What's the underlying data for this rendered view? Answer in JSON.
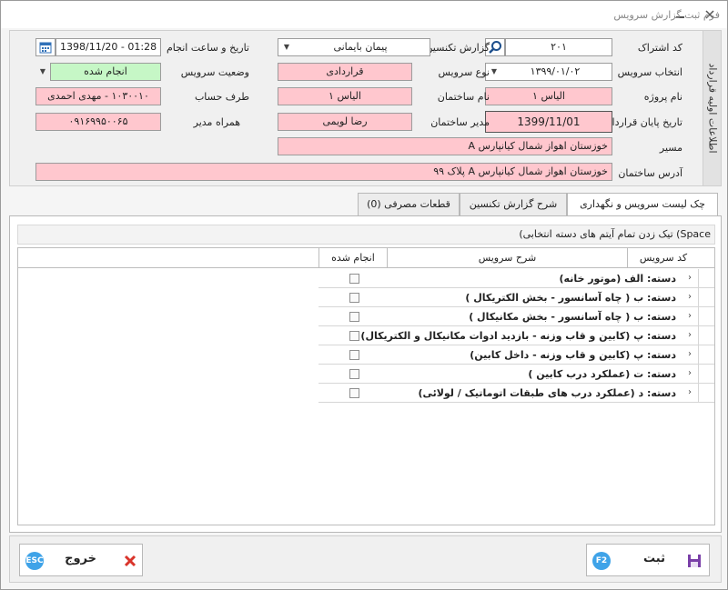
{
  "window": {
    "title": "فرم ثبت گزارش سرویس",
    "minimize_icon": "minimize-icon",
    "close_icon": "close-icon"
  },
  "side_caption": "اطلاعات اولیه قرارداد",
  "form": {
    "subscription_code": {
      "label": "کد اشتراک",
      "value": "۲۰۱"
    },
    "service_select": {
      "label": "انتخاب سرویس",
      "value": "۱۳۹۹/۰۱/۰۲"
    },
    "project_name": {
      "label": "نام پروژه",
      "value": "الیاس ۱"
    },
    "contract_end_date": {
      "label": "تاریخ پایان قرارداد",
      "value": "1399/11/01"
    },
    "technician_report": {
      "label": "گزارش تکنسین",
      "value": "پیمان بایمانی"
    },
    "service_type": {
      "label": "نوع سرویس",
      "value": "قراردادی"
    },
    "building_name": {
      "label": "نام ساختمان",
      "value": "الیاس ۱"
    },
    "building_manager": {
      "label": "مدیر ساختمان",
      "value": "رضا لویمی"
    },
    "done_datetime": {
      "label": "تاریخ و ساعت انجام",
      "value": "1398/11/20 - 01:28"
    },
    "service_status": {
      "label": "وضعیت سرویس",
      "value": "انجام شده"
    },
    "account_party": {
      "label": "طرف حساب",
      "value": "۱۰۳۰۰۱۰ - مهدی احمدی"
    },
    "manager_mobile": {
      "label": "همراه مدیر",
      "value": "۰۹۱۶۹۹۵۰۰۶۵"
    },
    "route": {
      "label": "مسیر",
      "value": "خوزستان اهواز شمال کیانپارس A"
    },
    "building_address": {
      "label": "آدرس ساختمان",
      "value": "خوزستان اهواز شمال کیانپارس A پلاک ۹۹"
    }
  },
  "tabs": [
    {
      "label": "چک لیست سرویس و نگهداری",
      "active": true
    },
    {
      "label": "شرح گزارش تکنسین",
      "active": false
    },
    {
      "label": "قطعات مصرفی (0)",
      "active": false
    }
  ],
  "hint": "Space) تیک زدن تمام آیتم های دسته انتخابی)",
  "grid": {
    "columns": {
      "code": "کد سرویس",
      "description": "شرح سرویس",
      "done": "انجام شده"
    },
    "rows": [
      {
        "label": "دسته: الف (موتور خانه)"
      },
      {
        "label": "دسته: ب ( چاه آسانسور - بخش الکتریکال )"
      },
      {
        "label": "دسته: ب ( چاه آسانسور - بخش مکانیکال )"
      },
      {
        "label": "دسته: پ (کابین و قاب وزنه - بازدید ادوات مکانیکال و الکتریکال)"
      },
      {
        "label": "دسته: پ (کابین و قاب وزنه - داخل کابین)"
      },
      {
        "label": "دسته: ت (عملکرد درب کابین )"
      },
      {
        "label": "دسته: د (عملکرد درب های طبقات اتوماتیک / لولائی)"
      }
    ]
  },
  "footer": {
    "save": {
      "label": "ثبت",
      "shortcut": "F2"
    },
    "exit": {
      "label": "خروج",
      "shortcut": "ESC"
    }
  },
  "colors": {
    "required": "#ffc7ce",
    "status_done": "#c6f7c6",
    "badge": "#3fa3e8",
    "exit_icon": "#d9342b",
    "save_icon": "#7a3fa8"
  }
}
